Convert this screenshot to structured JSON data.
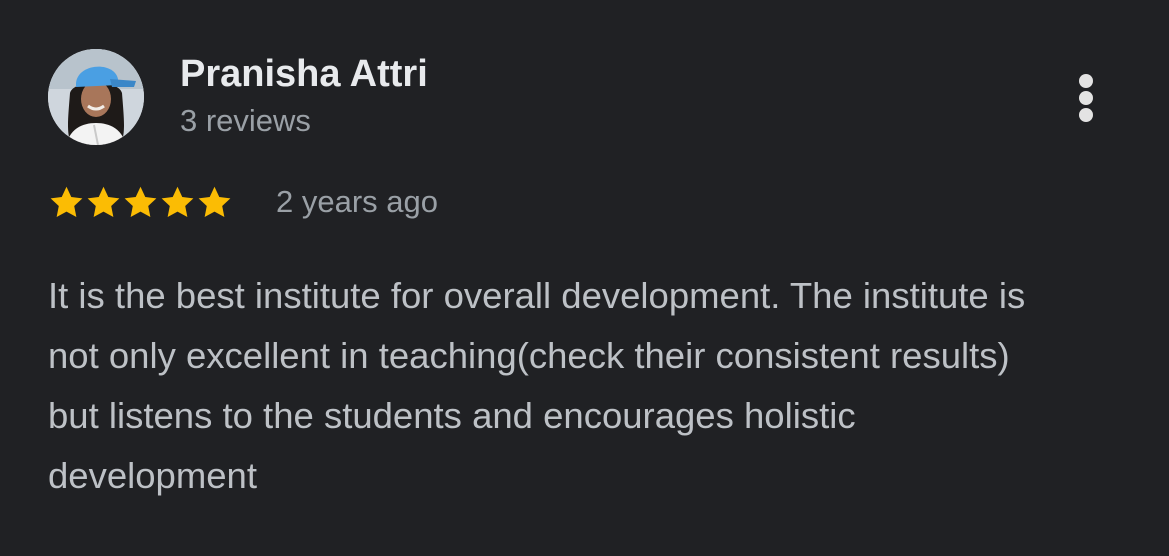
{
  "review": {
    "author_name": "Pranisha Attri",
    "review_count": "3 reviews",
    "rating": 5,
    "rating_max": 5,
    "time_ago": "2 years ago",
    "text": "It is the best institute for overall development. The institute is not only excellent in teaching(check their consistent results) but listens to the students and encourages holistic development"
  },
  "icons": {
    "star": "star-icon",
    "more": "more-vert-icon",
    "avatar": "avatar"
  },
  "colors": {
    "background": "#202124",
    "name": "#e8eaed",
    "secondary": "#9aa0a6",
    "body": "#bdc1c6",
    "star": "#fbbc04"
  }
}
